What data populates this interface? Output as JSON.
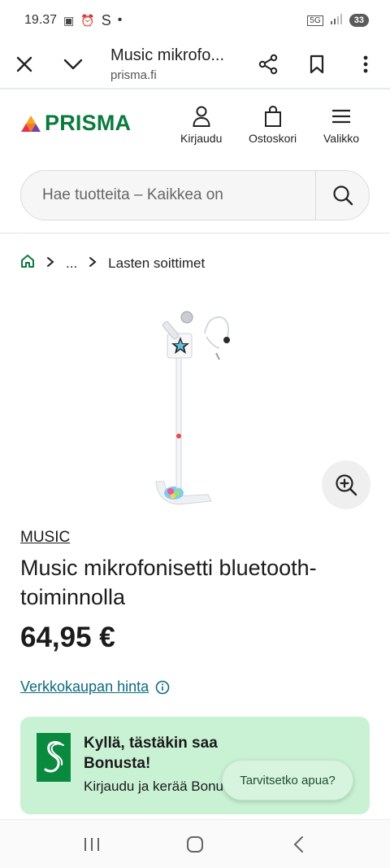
{
  "status_bar": {
    "time": "19.37",
    "indicators": "S",
    "dot": "•",
    "network": "5G",
    "battery": "33"
  },
  "browser": {
    "title": "Music mikrofo...",
    "url": "prisma.fi"
  },
  "header": {
    "logo_text": "PRISMA",
    "login_label": "Kirjaudu",
    "cart_label": "Ostoskori",
    "menu_label": "Valikko"
  },
  "search": {
    "placeholder": "Hae tuotteita – Kaikkea on"
  },
  "breadcrumb": {
    "ellipsis": "...",
    "current": "Lasten soittimet"
  },
  "product": {
    "brand": "MUSIC",
    "title": "Music mikrofonisetti bluetooth-toiminnolla",
    "price": "64,95 €",
    "online_price_label": "Verkkokaupan hinta"
  },
  "bonus_card": {
    "title": "Kyllä, tästäkin saa Bonusta!",
    "subtitle": "Kirjaudu ja kerää Bonusta"
  },
  "help": {
    "label": "Tarvitsetko apua?"
  },
  "colors": {
    "brand_green": "#0a7a3d",
    "link_teal": "#0b6b7d",
    "bonus_bg": "#c9f2d5"
  }
}
